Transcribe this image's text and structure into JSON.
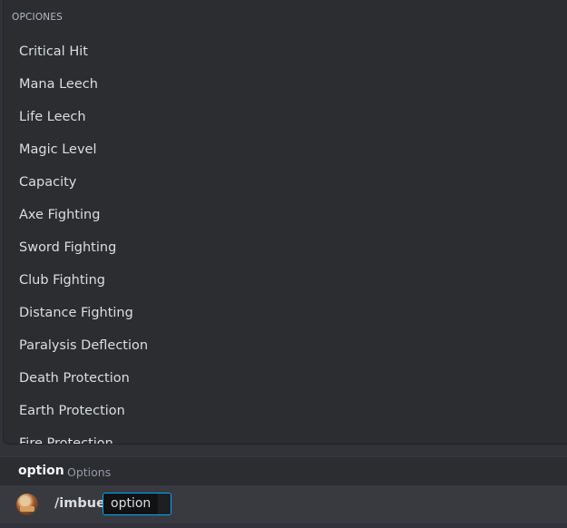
{
  "popup": {
    "header": "OPCIONES",
    "options": [
      "Critical Hit",
      "Mana Leech",
      "Life Leech",
      "Magic Level",
      "Capacity",
      "Axe Fighting",
      "Sword Fighting",
      "Club Fighting",
      "Distance Fighting",
      "Paralysis Deflection",
      "Death Protection",
      "Earth Protection",
      "Fire Protection"
    ]
  },
  "hint": {
    "name": "option",
    "description": "Options"
  },
  "input": {
    "avatar_icon": "user-avatar",
    "command": "/imbue",
    "argument_label": "option",
    "argument_value": ""
  },
  "colors": {
    "background": "#313338",
    "popup_background": "#2b2d31",
    "input_background": "#383a40",
    "accent_focus": "#00a8fc",
    "text_primary": "#dbdee1",
    "text_muted": "#949ba4"
  }
}
